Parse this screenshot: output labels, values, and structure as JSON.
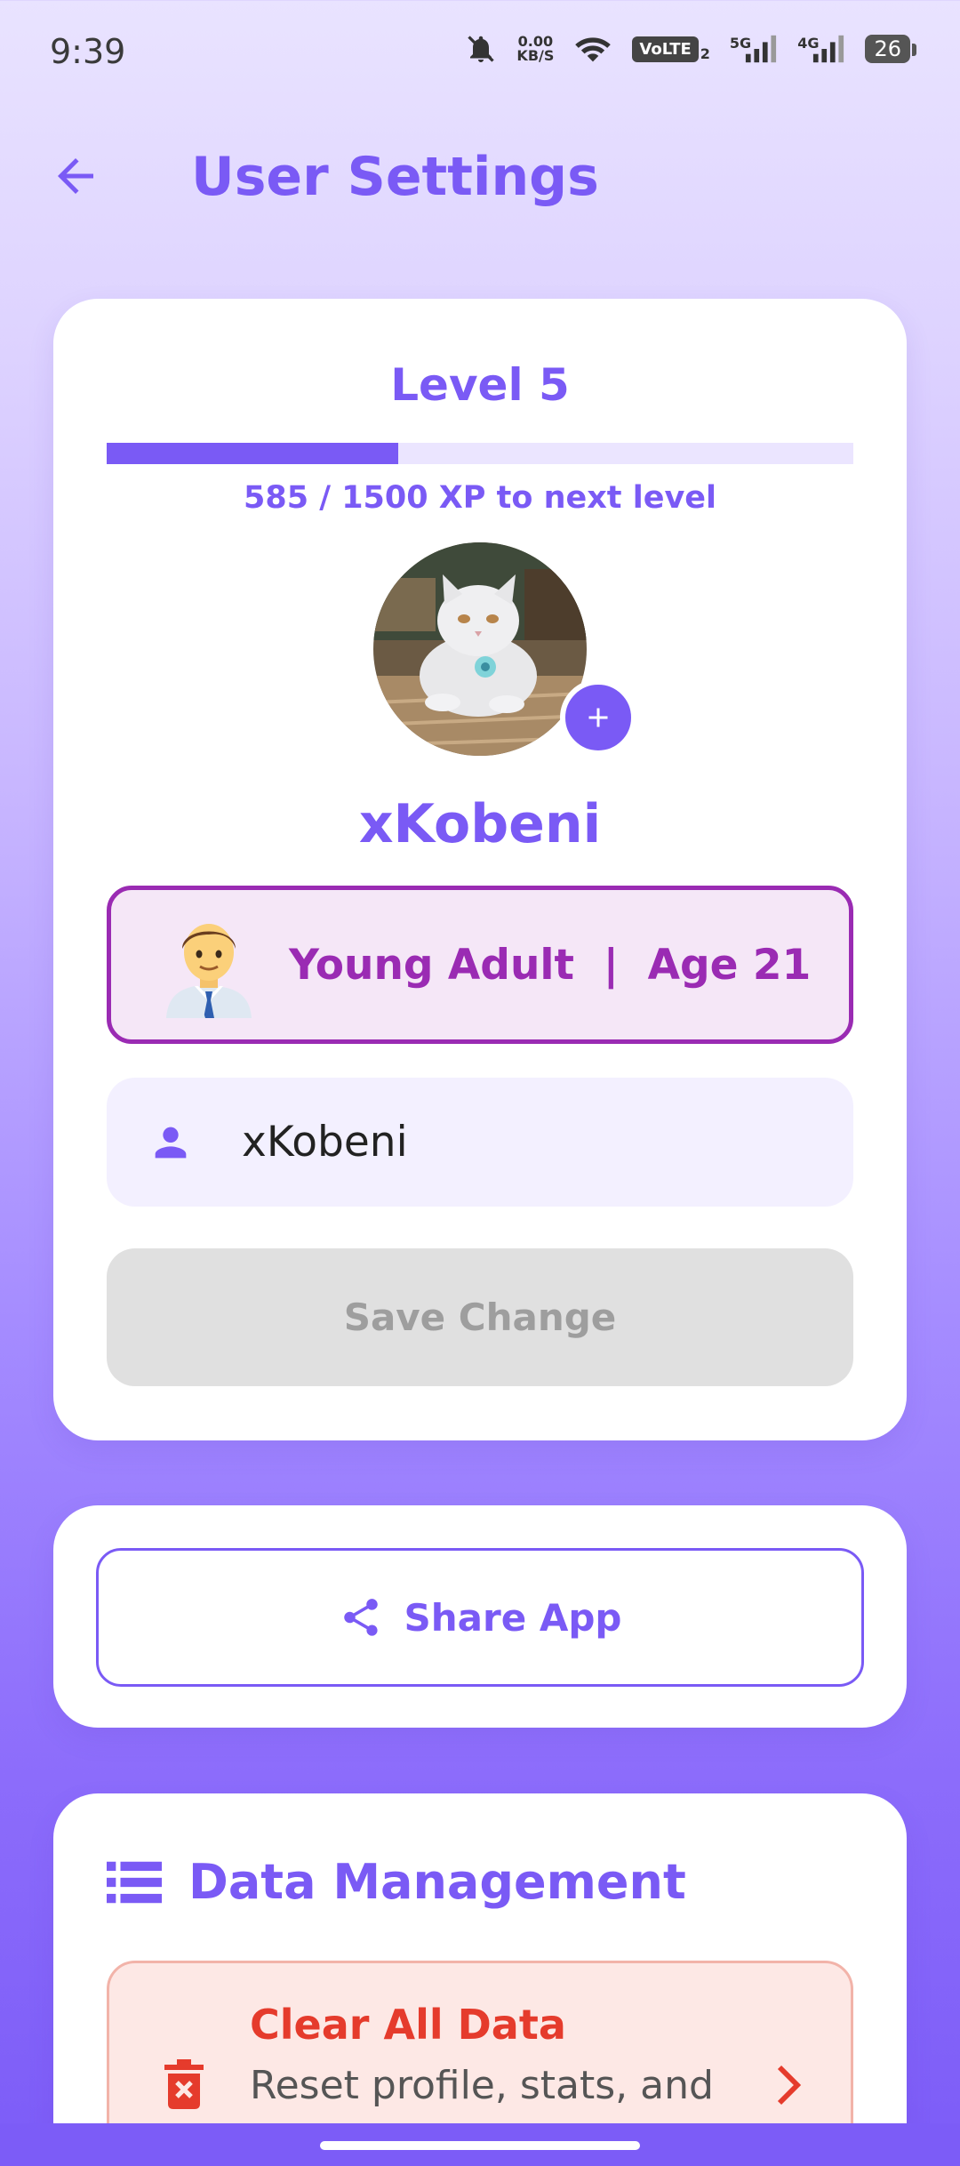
{
  "status_bar": {
    "time": "9:39",
    "net_speed_value": "0.00",
    "net_speed_unit": "KB/S",
    "volte": "VoLTE",
    "volte_sub": "2",
    "sig1_label": "5G",
    "sig2_label": "4G",
    "battery": "26"
  },
  "header": {
    "title": "User Settings",
    "back_icon": "arrow-left-icon"
  },
  "profile": {
    "level_title": "Level 5",
    "xp_current": 585,
    "xp_needed": 1500,
    "xp_text": "585 / 1500 XP to next level",
    "xp_progress_fraction": 0.39,
    "username_display": "xKobeni",
    "age_group_text": "Young Adult  |  Age 21",
    "age_emoji": "man-office-worker-icon",
    "username_input_value": "xKobeni",
    "save_button_label": "Save Change"
  },
  "share": {
    "label": "Share App",
    "icon": "share-icon"
  },
  "data_management": {
    "title": "Data Management",
    "icon": "list-icon",
    "clear_title": "Clear All Data",
    "clear_subtitle": "Reset profile, stats, and"
  },
  "colors": {
    "accent": "#7a5af5",
    "age_accent": "#9a2bb3",
    "danger": "#e53b2c"
  }
}
